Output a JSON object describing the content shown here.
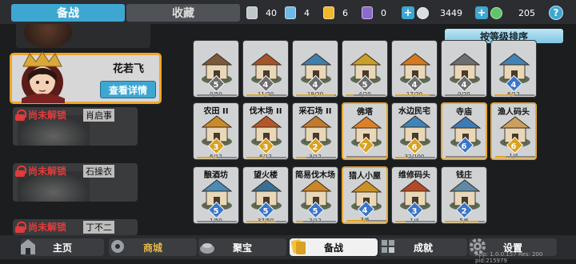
{
  "tabs": {
    "prep": "备战",
    "collection": "收藏"
  },
  "resources": [
    {
      "name": "silver-token",
      "value": "40",
      "color": "#bfc6cc"
    },
    {
      "name": "blue-token",
      "value": "4",
      "color": "#6fb9e6"
    },
    {
      "name": "gold-token",
      "value": "6",
      "color": "#f0b72c"
    },
    {
      "name": "purple-token",
      "value": "0",
      "color": "#8a6bc9"
    },
    {
      "name": "silver-coin",
      "value": "3449",
      "color": "#d8dde2"
    },
    {
      "name": "jade",
      "value": "205",
      "color": "#5fc46a"
    }
  ],
  "help_label": "?",
  "sort_label": "按等级排序",
  "hero": {
    "name": "花若飞",
    "detail_label": "查看详情"
  },
  "locked_slots": [
    {
      "label": "尚未解锁",
      "sub": "肖启事"
    },
    {
      "label": "尚未解锁",
      "sub": "石操衣"
    },
    {
      "label": "尚未解锁",
      "sub": "丁不二"
    }
  ],
  "buildings": [
    {
      "name": "",
      "level": "5",
      "progress": "0/50",
      "color": "#7b5a3c",
      "lv_color": "#6e6e6e",
      "gold": false,
      "fill": 0
    },
    {
      "name": "",
      "level": "4",
      "progress": "11/20",
      "color": "#a4542c",
      "lv_color": "#6e6e6e",
      "gold": false,
      "fill": 0.55
    },
    {
      "name": "",
      "level": "4",
      "progress": "19/20",
      "color": "#3f7fb0",
      "lv_color": "#6e6e6e",
      "gold": false,
      "fill": 0.95
    },
    {
      "name": "",
      "level": "5",
      "progress": "4/20",
      "color": "#c9a02a",
      "lv_color": "#6e6e6e",
      "gold": false,
      "fill": 0.2
    },
    {
      "name": "",
      "level": "4",
      "progress": "17/20",
      "color": "#d47a22",
      "lv_color": "#6e6e6e",
      "gold": false,
      "fill": 0.85
    },
    {
      "name": "",
      "level": "4",
      "progress": "0/20",
      "color": "#6b6f74",
      "lv_color": "#6e6e6e",
      "gold": false,
      "fill": 0
    },
    {
      "name": "",
      "level": "4",
      "progress": "6/12",
      "color": "#3e84b8",
      "lv_color": "#3a76c8",
      "gold": false,
      "fill": 0.5
    },
    {
      "name": "农田 II",
      "level": "3",
      "progress": "6/12",
      "color": "#c98a2a",
      "lv_color": "#d9a122",
      "gold": false,
      "fill": 0.5
    },
    {
      "name": "伐木场 II",
      "level": "3",
      "progress": "6/12",
      "color": "#b5562a",
      "lv_color": "#d9a122",
      "gold": false,
      "fill": 0.5
    },
    {
      "name": "采石场 II",
      "level": "2",
      "progress": "3/12",
      "color": "#c07a30",
      "lv_color": "#d9a122",
      "gold": false,
      "fill": 0.25
    },
    {
      "name": "佛塔",
      "level": "7",
      "progress": "",
      "color": "#d9822b",
      "lv_color": "#d9a122",
      "gold": true,
      "fill": 0
    },
    {
      "name": "水边民宅",
      "level": "6",
      "progress": "32/100",
      "color": "#3e84b8",
      "lv_color": "#d9a122",
      "gold": false,
      "fill": 0.32
    },
    {
      "name": "寺庙",
      "level": "6",
      "progress": "",
      "color": "#3e7bb5",
      "lv_color": "#3a76c8",
      "gold": true,
      "fill": 0
    },
    {
      "name": "渔人码头",
      "level": "6",
      "progress": "1/4",
      "color": "#c9a060",
      "lv_color": "#d9a122",
      "gold": true,
      "fill": 0.25
    },
    {
      "name": "酿酒坊",
      "level": "5",
      "progress": "1/50",
      "color": "#4a8bb8",
      "lv_color": "#3a76c8",
      "gold": false,
      "fill": 0.02
    },
    {
      "name": "望火楼",
      "level": "5",
      "progress": "37/50",
      "color": "#3a6f96",
      "lv_color": "#3a76c8",
      "gold": false,
      "fill": 0.74
    },
    {
      "name": "简易伐木场",
      "level": "5",
      "progress": "2/12",
      "color": "#c9872a",
      "lv_color": "#3a76c8",
      "gold": false,
      "fill": 0.17
    },
    {
      "name": "猎人小屋",
      "level": "4",
      "progress": "3/6",
      "color": "#c8922a",
      "lv_color": "#3a76c8",
      "gold": true,
      "fill": 0.5
    },
    {
      "name": "维修码头",
      "level": "3",
      "progress": "1/4",
      "color": "#b24a2a",
      "lv_color": "#3a76c8",
      "gold": false,
      "fill": 0.25
    },
    {
      "name": "钱庄",
      "level": "2",
      "progress": "5/6",
      "color": "#5e8aa8",
      "lv_color": "#3a76c8",
      "gold": false,
      "fill": 0.83
    }
  ],
  "nav": [
    {
      "label": "主页",
      "icon": "home-icon"
    },
    {
      "label": "商城",
      "icon": "shop-icon"
    },
    {
      "label": "聚宝",
      "icon": "treasure-icon"
    },
    {
      "label": "备战",
      "icon": "prep-icon"
    },
    {
      "label": "成就",
      "icon": "achievement-icon"
    },
    {
      "label": "设置",
      "icon": "gear-icon"
    }
  ],
  "version": "App: 1.0.0.157 Res: 200 pid:215979"
}
